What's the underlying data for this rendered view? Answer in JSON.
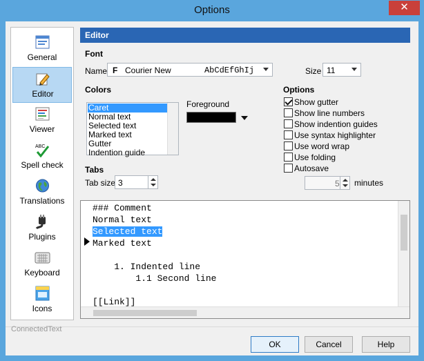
{
  "window": {
    "title": "Options",
    "close_symbol": "✕"
  },
  "sidebar": {
    "items": [
      {
        "label": "General",
        "icon": "window-icon"
      },
      {
        "label": "Editor",
        "icon": "pencil-icon",
        "active": true
      },
      {
        "label": "Viewer",
        "icon": "viewer-icon"
      },
      {
        "label": "Spell check",
        "icon": "spell-check-icon",
        "badge": "ABC"
      },
      {
        "label": "Translations",
        "icon": "globe-icon"
      },
      {
        "label": "Plugins",
        "icon": "plug-icon"
      },
      {
        "label": "Keyboard",
        "icon": "keyboard-icon"
      },
      {
        "label": "Icons",
        "icon": "icons-icon"
      }
    ]
  },
  "header": {
    "title": "Editor"
  },
  "font": {
    "section_title": "Font",
    "name_label": "Name",
    "name_value": "Courier New",
    "sample": "AbCdEfGhIj",
    "size_label": "Size",
    "size_value": "11"
  },
  "colors": {
    "section_title": "Colors",
    "items": [
      "Caret",
      "Normal text",
      "Selected text",
      "Marked text",
      "Gutter",
      "Indention guide"
    ],
    "foreground_label": "Foreground",
    "foreground_color": "#000000"
  },
  "options": {
    "section_title": "Options",
    "items": [
      {
        "label": "Show gutter",
        "checked": true
      },
      {
        "label": "Show line numbers",
        "checked": false
      },
      {
        "label": "Show indention guides",
        "checked": false
      },
      {
        "label": "Use syntax highlighter",
        "checked": false
      },
      {
        "label": "Use word wrap",
        "checked": false
      },
      {
        "label": "Use folding",
        "checked": false
      },
      {
        "label": "Autosave",
        "checked": false
      }
    ],
    "autosave_value": "5",
    "minutes_label": "minutes"
  },
  "tabs": {
    "section_title": "Tabs",
    "tab_size_label": "Tab size",
    "tab_size_value": "3"
  },
  "preview": {
    "lines": [
      "### Comment",
      "Normal text",
      "Selected text",
      "Marked text",
      "",
      "    1. Indented line",
      "        1.1 Second line",
      "",
      "[[Link]]"
    ]
  },
  "footer": {
    "app_name": "ConnectedText",
    "ok_label": "OK",
    "cancel_label": "Cancel",
    "help_label": "Help"
  },
  "colors_theme": {
    "header": "#2a66b4",
    "selection": "#3399ff",
    "window": "#5aa6dd"
  }
}
